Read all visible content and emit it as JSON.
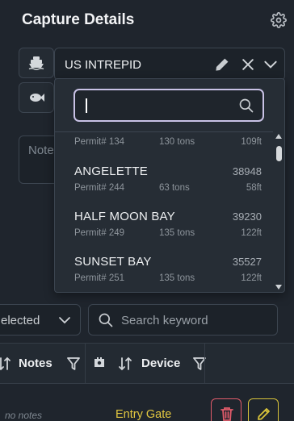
{
  "header": {
    "title": "Capture Details"
  },
  "vessel": {
    "selected": "US INTREPID",
    "search_value": "",
    "items": [
      {
        "name": "",
        "code": "",
        "permit": "Permit# 134",
        "tons": "130 tons",
        "length": "109ft"
      },
      {
        "name": "ANGELETTE",
        "code": "38948",
        "permit": "Permit# 244",
        "tons": "63 tons",
        "length": "58ft"
      },
      {
        "name": "HALF MOON BAY",
        "code": "39230",
        "permit": "Permit# 249",
        "tons": "135 tons",
        "length": "122ft"
      },
      {
        "name": "SUNSET BAY",
        "code": "35527",
        "permit": "Permit# 251",
        "tons": "135 tons",
        "length": "122ft"
      }
    ]
  },
  "notes": {
    "placeholder": "Note"
  },
  "filters": {
    "status_selected": "elected",
    "search_placeholder": "Search keyword"
  },
  "table": {
    "columns": {
      "notes": "Notes",
      "device": "Device"
    },
    "rows": [
      {
        "notes": "no notes",
        "device": "Entry Gate"
      }
    ]
  },
  "colors": {
    "accent_focus": "#c9c2e6",
    "device_text": "#e3c840",
    "delete": "#e05b6a",
    "edit": "#d8c33a"
  },
  "icons": {
    "gear": "gear-icon",
    "ship": "ship-icon",
    "fish": "fish-icon",
    "pencil": "pencil-icon",
    "close": "close-icon",
    "chevron": "chevron-down-icon",
    "search": "search-icon",
    "filter": "filter-icon",
    "sort": "sort-icon",
    "trash": "trash-icon",
    "device": "device-icon"
  }
}
